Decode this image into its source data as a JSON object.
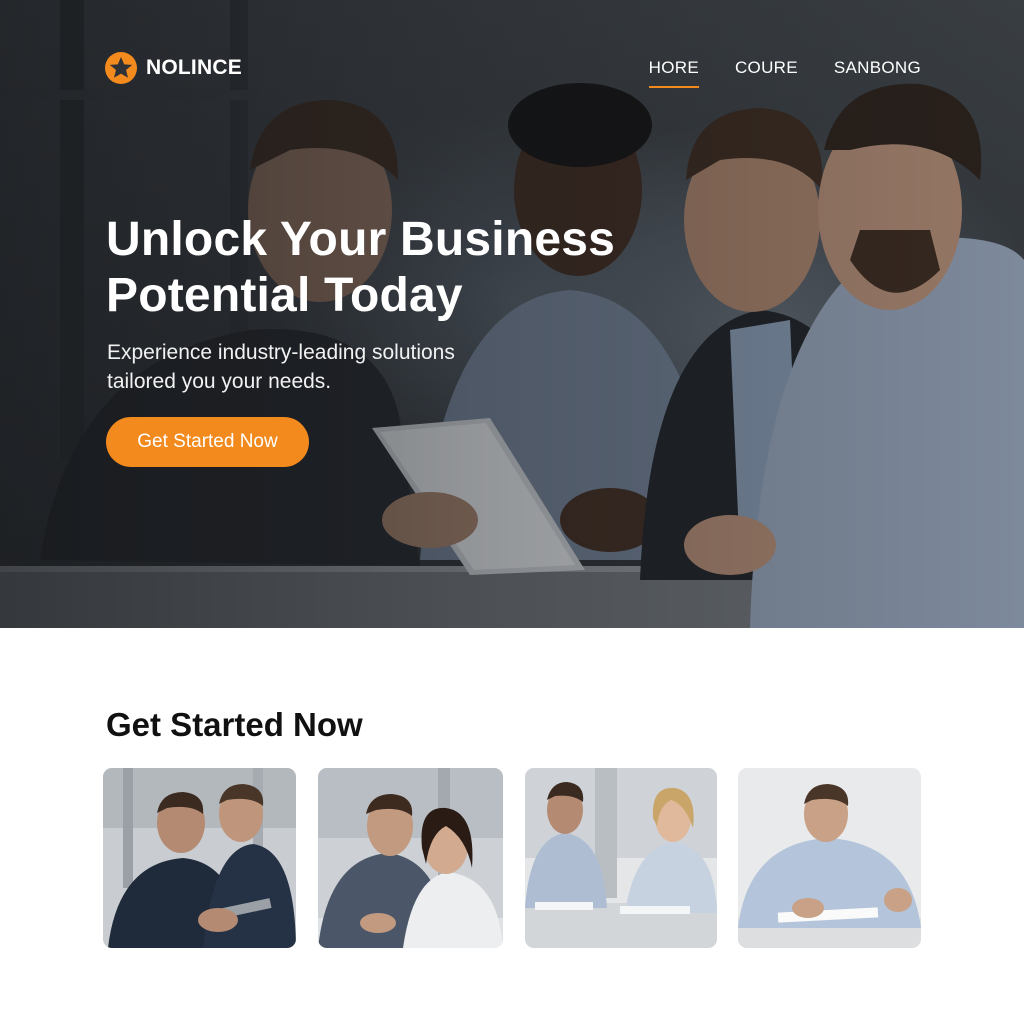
{
  "brand": {
    "name": "NOLINCE",
    "logo_icon": "star-badge-icon",
    "accent_color": "#f28a1e"
  },
  "nav": {
    "items": [
      {
        "label": "HORE",
        "active": true
      },
      {
        "label": "COURE",
        "active": false
      },
      {
        "label": "SANBONG",
        "active": false
      }
    ]
  },
  "hero": {
    "title_line1": "Unlock Your Business",
    "title_line2": "Potential Today",
    "subtitle_line1": "Experience industry-leading solutions",
    "subtitle_line2": "tailored you your needs.",
    "cta_label": "Get Started Now"
  },
  "section": {
    "title": "Get Started Now"
  }
}
